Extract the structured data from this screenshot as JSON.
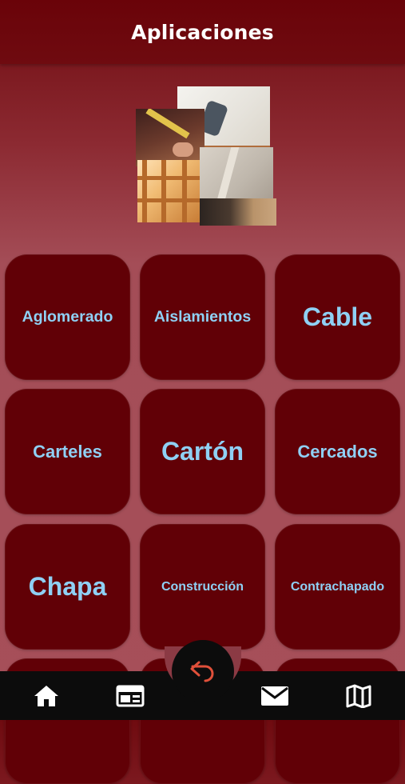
{
  "header": {
    "title": "Aplicaciones"
  },
  "tiles": [
    {
      "label": "Aglomerado"
    },
    {
      "label": "Aislamientos"
    },
    {
      "label": "Cable"
    },
    {
      "label": "Carteles"
    },
    {
      "label": "Cartón"
    },
    {
      "label": "Cercados"
    },
    {
      "label": "Chapa"
    },
    {
      "label": "Construcción"
    },
    {
      "label": "Contrachapado"
    }
  ],
  "navbar": {
    "items": [
      {
        "icon": "home-icon"
      },
      {
        "icon": "newspaper-icon"
      },
      {
        "icon": "mail-icon"
      },
      {
        "icon": "map-icon"
      }
    ],
    "center": {
      "icon": "undo-icon"
    }
  },
  "colors": {
    "header": "#6a0309",
    "tile": "#610006",
    "tile_text": "#8fd0f4",
    "navbar": "#0c0c0c",
    "undo_icon": "#e0503a"
  }
}
